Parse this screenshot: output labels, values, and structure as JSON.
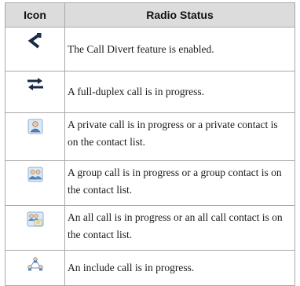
{
  "table": {
    "headers": {
      "icon": "Icon",
      "status": "Radio Status"
    },
    "rows": [
      {
        "icon": "call-divert-icon",
        "text": "The Call Divert feature is enabled."
      },
      {
        "icon": "full-duplex-call-icon",
        "text": "A full-duplex call is in progress."
      },
      {
        "icon": "private-call-icon",
        "text": "A private call is in progress or a private contact is on the contact list."
      },
      {
        "icon": "group-call-icon",
        "text": "A group call is in progress or a group contact is on the contact list."
      },
      {
        "icon": "all-call-icon",
        "text": "An all call is in progress or an all call contact is on the contact list."
      },
      {
        "icon": "include-call-icon",
        "text": "An include call is in progress."
      }
    ]
  },
  "colors": {
    "header_bg": "#dcdcdc",
    "border": "#a8a8a8",
    "icon_dark": "#1a2a44",
    "icon_blue": "#4a86c8"
  }
}
